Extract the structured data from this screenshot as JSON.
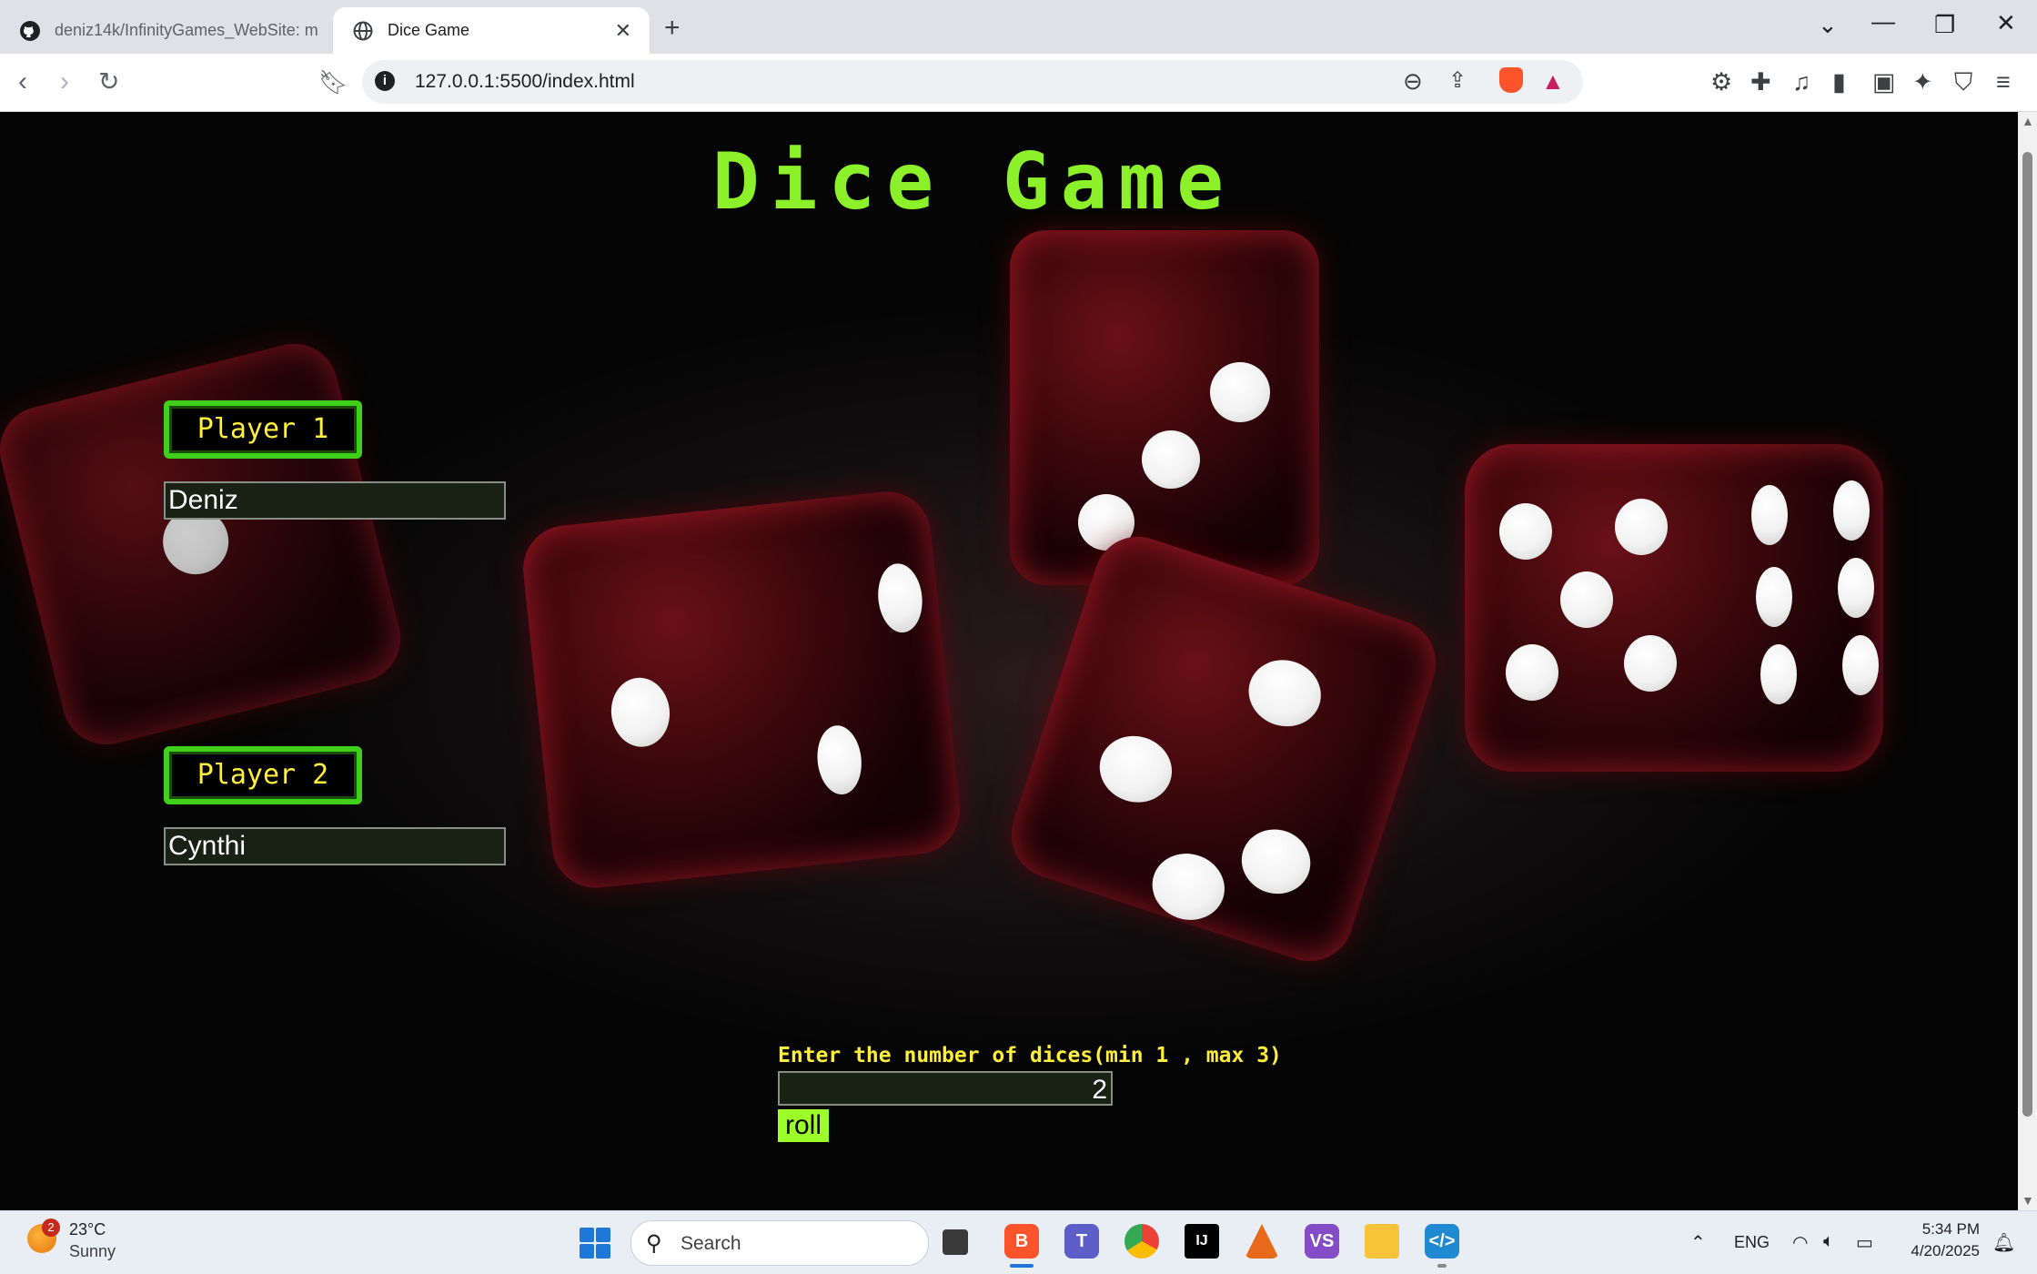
{
  "browser": {
    "tabs": [
      {
        "title": "deniz14k/InfinityGames_WebSite: m",
        "icon": "github-icon"
      },
      {
        "title": "Dice Game",
        "icon": "globe-icon",
        "active": true
      }
    ],
    "url": "127.0.0.1:5500/index.html"
  },
  "page": {
    "title": "Dice Game",
    "player1": {
      "label": "Player 1",
      "name": "Deniz"
    },
    "player2": {
      "label": "Player 2",
      "name": "Cynthi"
    },
    "dice_prompt": "Enter the number of dices(min 1 , max 3)",
    "dice_count": "2",
    "roll_label": "roll",
    "colors": {
      "title": "#8cf12a",
      "label_text": "#ffee3a",
      "label_border": "#3fd11a",
      "roll_button": "#9dff2a"
    }
  },
  "taskbar": {
    "weather": {
      "temp": "23°C",
      "condition": "Sunny",
      "badge": "2"
    },
    "search_label": "Search",
    "language": "ENG",
    "time": "5:34 PM",
    "date": "4/20/2025"
  }
}
